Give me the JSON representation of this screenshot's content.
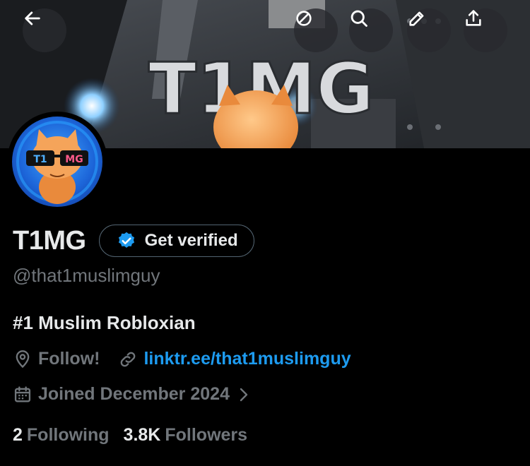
{
  "banner": {
    "title_text": "T1MG"
  },
  "toolbar": {
    "back_icon": "arrow-left-icon",
    "refresh_icon": "refresh-icon",
    "search_icon": "search-icon",
    "edit_icon": "pencil-icon",
    "share_icon": "share-icon"
  },
  "avatar": {
    "text_left": "T1",
    "text_right": "MG"
  },
  "profile": {
    "display_name": "T1MG",
    "verify_label": "Get verified",
    "handle": "@that1muslimguy",
    "bio": "#1 Muslim Robloxian",
    "location": "Follow!",
    "website": "linktr.ee/that1muslimguy",
    "joined": "Joined December 2024",
    "following_count": "2",
    "following_label": "Following",
    "followers_count": "3.8K",
    "followers_label": "Followers"
  },
  "colors": {
    "accent": "#1d9bf0",
    "muted": "#71767b",
    "text": "#e7e9ea",
    "background": "#000000"
  }
}
